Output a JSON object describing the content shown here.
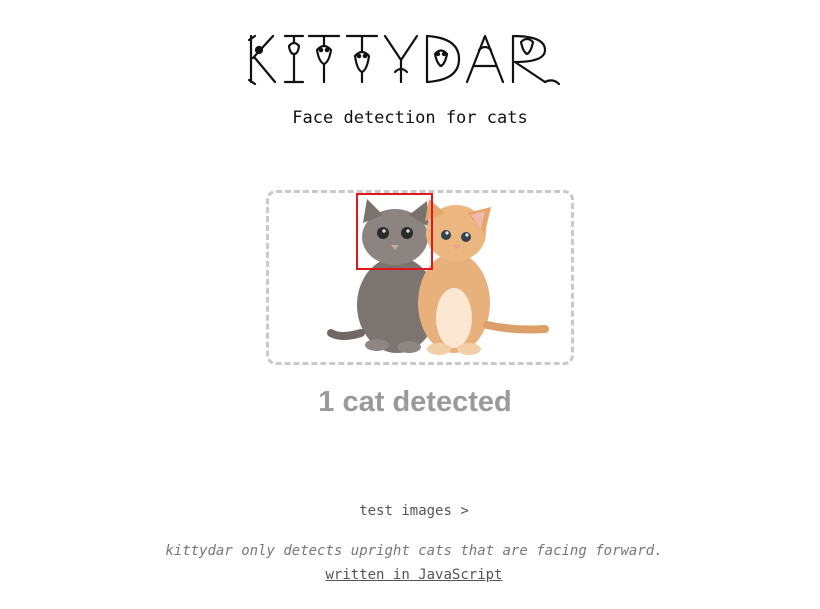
{
  "header": {
    "logo_text": "KITTYDAR",
    "subtitle": "Face detection for cats"
  },
  "viewer": {
    "status": "1 cat detected"
  },
  "footer": {
    "test_images_link": "test images >",
    "note": "kittydar only detects upright cats that are facing forward.",
    "written_link": "written in JavaScript"
  },
  "colors": {
    "detection_box": "#e0171b",
    "dropzone_border": "#c9c9c9",
    "status_text": "#9a9a9a"
  }
}
